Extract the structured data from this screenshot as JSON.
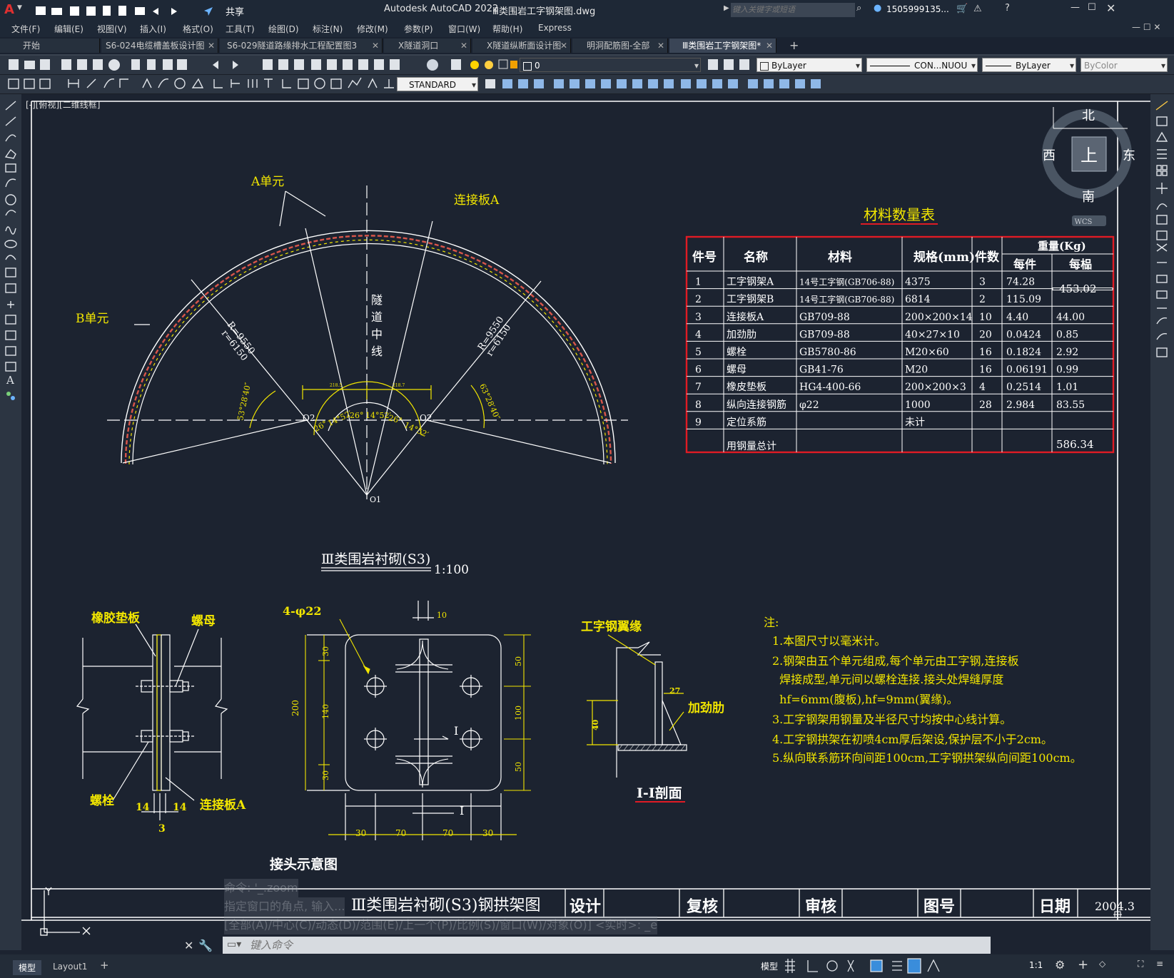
{
  "app": {
    "title": "Autodesk AutoCAD 2022",
    "filename": "Ⅲ类围岩工字钢架图.dwg",
    "search_placeholder": "键入关键字或短语",
    "user": "1505999135...",
    "share": "共享"
  },
  "menu": [
    "文件(F)",
    "编辑(E)",
    "视图(V)",
    "插入(I)",
    "格式(O)",
    "工具(T)",
    "绘图(D)",
    "标注(N)",
    "修改(M)",
    "参数(P)",
    "窗口(W)",
    "帮助(H)",
    "Express"
  ],
  "tabs": [
    {
      "label": "开始",
      "closable": false,
      "active": false
    },
    {
      "label": "S6-024电缆槽盖板设计图",
      "closable": true,
      "active": false
    },
    {
      "label": "S6-029隧道路缘排水工程配置图3",
      "closable": true,
      "active": false
    },
    {
      "label": "X隧道洞口",
      "closable": true,
      "active": false
    },
    {
      "label": "X隧道纵断面设计图",
      "closable": true,
      "active": false
    },
    {
      "label": "明洞配筋图-全部",
      "closable": true,
      "active": false
    },
    {
      "label": "Ⅲ类围岩工字钢架图*",
      "closable": true,
      "active": true
    }
  ],
  "toolbar": {
    "layer": "0",
    "color": "ByLayer",
    "linetype": "CON...NUOU",
    "lineweight": "ByLayer",
    "plotstyle": "ByColor",
    "textstyle": "STANDARD"
  },
  "viewport_label": "[-][俯视][二维线框]",
  "viewcube": {
    "north": "北",
    "south": "南",
    "east": "东",
    "west": "西",
    "top": "上",
    "wcs": "WCS"
  },
  "drawing": {
    "arch": {
      "label_a": "A单元",
      "label_b": "B单元",
      "label_plate": "连接板A",
      "centerline": [
        "隧",
        "道",
        "中",
        "线"
      ],
      "radius_left": [
        "R=9550",
        "r=6150"
      ],
      "radius_right": [
        "R=9550",
        "r=6150"
      ],
      "angle_left": "53°28′40″",
      "angle_right": "63°28′40″",
      "angles_bottom": [
        "26°",
        "14°52′",
        "26°",
        "14°52′",
        "26°",
        "14°52′"
      ],
      "o1": "O1",
      "o2_left": "O2",
      "o2_right": "O2",
      "dims_top": [
        "218.5",
        "218.7"
      ],
      "title": "Ⅲ类围岩衬砌(S3)",
      "scale": "1:100"
    },
    "table": {
      "title": "材料数量表",
      "headers": [
        "件号",
        "名称",
        "材料",
        "规格(mm)",
        "件数",
        "重量(Kg)",
        "每件",
        "每榀"
      ],
      "rows": [
        [
          "1",
          "工字钢架A",
          "14号工字钢(GB706-88)",
          "4375",
          "3",
          "74.28",
          ""
        ],
        [
          "2",
          "工字钢架B",
          "14号工字钢(GB706-88)",
          "6814",
          "2",
          "115.09",
          ""
        ],
        [
          "3",
          "连接板A",
          "GB709-88",
          "200×200×14",
          "10",
          "4.40",
          "44.00"
        ],
        [
          "4",
          "加劲肋",
          "GB709-88",
          "40×27×10",
          "20",
          "0.0424",
          "0.85"
        ],
        [
          "5",
          "螺栓",
          "GB5780-86",
          "M20×60",
          "16",
          "0.1824",
          "2.92"
        ],
        [
          "6",
          "螺母",
          "GB41-76",
          "M20",
          "16",
          "0.06191",
          "0.99"
        ],
        [
          "7",
          "橡皮垫板",
          "HG4-400-66",
          "200×200×3",
          "4",
          "0.2514",
          "1.01"
        ],
        [
          "8",
          "纵向连接钢筋",
          "φ22",
          "1000",
          "28",
          "2.984",
          "83.55"
        ],
        [
          "9",
          "定位系筋",
          "",
          "未计",
          "",
          "",
          ""
        ]
      ],
      "merged_weight": "453.02",
      "total_label": "用钢量总计",
      "total_value": "586.34"
    },
    "joint": {
      "labels": [
        "橡胶垫板",
        "螺母",
        "螺栓",
        "连接板A"
      ],
      "dims": [
        "14",
        "14",
        "3"
      ],
      "caption": "接头示意图"
    },
    "plate": {
      "label": "4-φ22",
      "dims_left": [
        "30",
        "140",
        "30"
      ],
      "dim_total": "200",
      "dims_right": [
        "50",
        "100",
        "50"
      ],
      "dims_bottom": [
        "30",
        "70",
        "70",
        "30"
      ],
      "dim_top": "10",
      "section_mark": "I"
    },
    "section": {
      "label_top": "工字钢翼缘",
      "label_rib": "加劲肋",
      "dim_27": "27",
      "dim_40": "40",
      "caption": "I-I剖面"
    },
    "notes": {
      "title": "注:",
      "items": [
        "1.本图尺寸以毫米计。",
        "2.钢架由五个单元组成,每个单元由工字钢,连接板",
        "  焊接成型,单元间以螺栓连接.接头处焊缝厚度",
        "  hf=6mm(腹板),hf=9mm(翼缘)。",
        "3.工字钢架用钢量及半径尺寸均按中心线计算。",
        "4.工字钢拱架在初喷4cm厚后架设,保护层不小于2cm。",
        "5.纵向联系筋环向间距100cm,工字钢拱架纵向间距100cm。"
      ]
    },
    "titleblock": {
      "name": "Ⅲ类围岩衬砌(S3)钢拱架图",
      "design": "设计",
      "check": "复核",
      "review": "审核",
      "drawing_no": "图号",
      "date_label": "日期",
      "date": "2004.3"
    }
  },
  "command": {
    "history": [
      "命令: '_.zoom",
      "指定窗口的角点, 输入...",
      "[全部(A)/中心(C)/动态(D)/范围(E)/上一个(P)/比例(S)/窗口(W)/对象(O)] <实时>: _e"
    ],
    "placeholder": "键入命令"
  },
  "status": {
    "layout_tabs": [
      "模型",
      "Layout1"
    ],
    "model": "模型",
    "scale": "1:1"
  },
  "colors": {
    "accent": "#f2e600",
    "table_border": "#e01b24",
    "background": "#1c2330"
  }
}
